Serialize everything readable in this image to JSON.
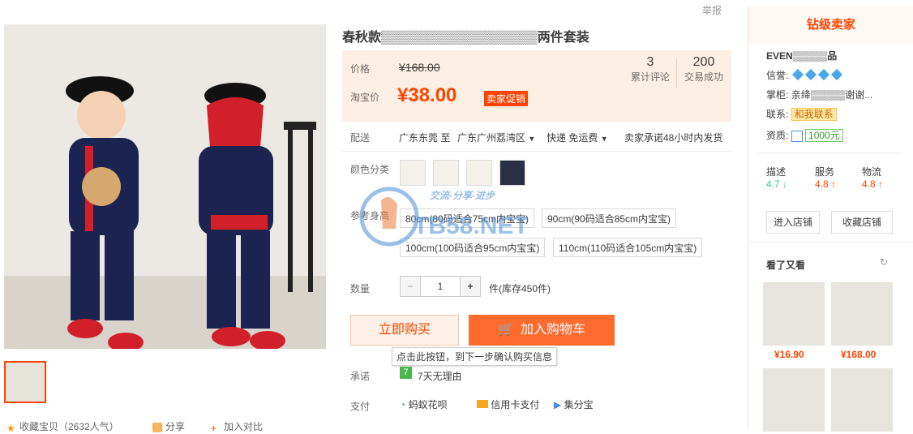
{
  "report": "举报",
  "title": "春秋款▒▒▒▒▒▒▒▒▒▒▒▒▒▒▒▒▒两件套装",
  "price": {
    "label": "价格",
    "original": "¥168.00"
  },
  "promo_price": {
    "label": "淘宝价",
    "value": "¥38.00",
    "badge": "卖家促销"
  },
  "stats": [
    {
      "num": "3",
      "text": "累计评论"
    },
    {
      "num": "200",
      "text": "交易成功"
    }
  ],
  "delivery": {
    "label": "配送",
    "from": "广东东莞 至",
    "to": "广东广州荔湾区",
    "fee": "快递 免运费",
    "promise": "卖家承诺48小时内发货"
  },
  "color": {
    "label": "颜色分类"
  },
  "size": {
    "label": "参考身高",
    "options": [
      "80cm(80码适合75cm内宝宝)",
      "90cm(90码适合85cm内宝宝)",
      "100cm(100码适合95cm内宝宝)",
      "110cm(110码适合105cm内宝宝)"
    ]
  },
  "quantity": {
    "label": "数量",
    "minus": "−",
    "value": "1",
    "plus": "+",
    "stock": "件(库存450件)"
  },
  "buttons": {
    "buy": "立即购买",
    "cart": "加入购物车",
    "tooltip": "点击此按钮，到下一步确认购买信息"
  },
  "promise": {
    "label": "承诺",
    "badge": "7",
    "text": "7天无理由"
  },
  "payment": {
    "label": "支付",
    "methods": [
      "蚂蚁花呗",
      "信用卡支付",
      "集分宝"
    ]
  },
  "util": {
    "fav": "收藏宝贝（2632人气）",
    "share": "分享",
    "compare": "加入对比"
  },
  "seller": {
    "level": "钻级卖家",
    "name": "EVEN▒▒▒▒▒品",
    "credit_label": "信誉:",
    "shopkeeper_label": "掌柜:",
    "shopkeeper": "亲绛▒▒▒▒▒谢谢...",
    "contact_label": "联系:",
    "contact": "和我联系",
    "qual_label": "资质:",
    "qual_badge": "1000元",
    "scores": [
      {
        "label": "描述",
        "value": "4.7",
        "arrow": "↓"
      },
      {
        "label": "服务",
        "value": "4.8",
        "arrow": "↑"
      },
      {
        "label": "物流",
        "value": "4.8",
        "arrow": "↑"
      }
    ],
    "enter_shop": "进入店铺",
    "fav_shop": "收藏店铺",
    "also_viewed": "看了又看",
    "rec_prices": [
      "¥16.90",
      "¥168.00"
    ]
  },
  "watermark": {
    "slogan": "交流-分享-进步",
    "site": "TB58.NET"
  },
  "colors": {
    "accent": "#ff4400",
    "price_bg": "#fdefe3",
    "cart_btn": "#ff6a2f"
  }
}
